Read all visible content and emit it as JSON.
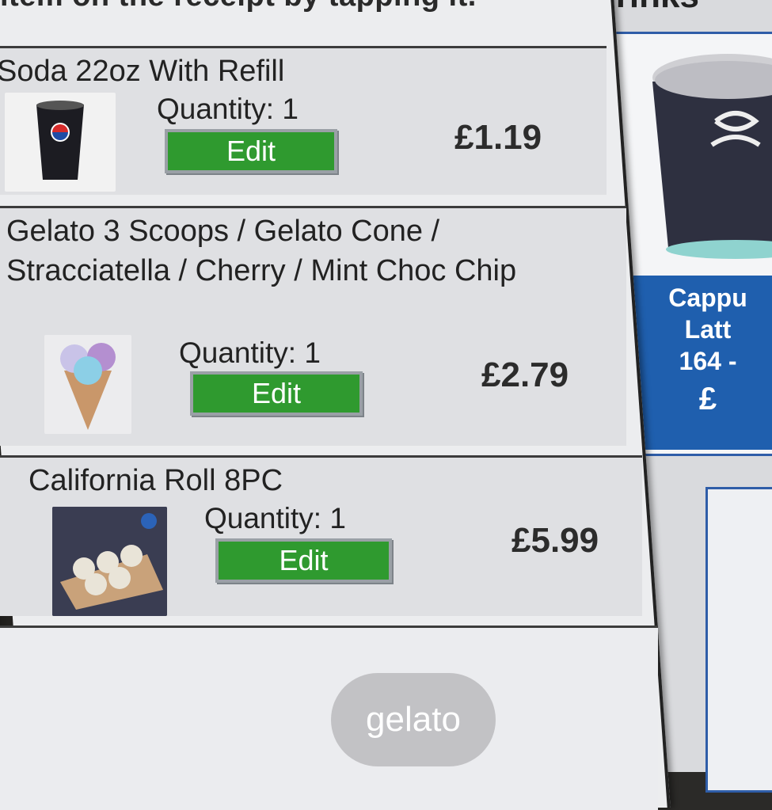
{
  "receipt": {
    "instruction": "item on the receipt by tapping it.",
    "items": [
      {
        "name": "Soda 22oz With Refill",
        "quantity": "Quantity: 1",
        "edit_label": "Edit",
        "price": "£1.19",
        "thumb_icon": "soda-cup-icon"
      },
      {
        "name": "Gelato 3 Scoops / Gelato Cone / Stracciatella / Cherry / Mint Choc Chip",
        "quantity": "Quantity: 1",
        "edit_label": "Edit",
        "price": "£2.79",
        "thumb_icon": "gelato-cone-icon"
      },
      {
        "name": "California Roll 8PC",
        "quantity": "Quantity: 1",
        "edit_label": "Edit",
        "price": "£5.99",
        "thumb_icon": "sushi-roll-icon"
      }
    ]
  },
  "drinks": {
    "title": "Drinks",
    "card": {
      "line1": "Cappu",
      "line2": "Latt",
      "line3": "164 -",
      "line4": "£"
    }
  },
  "search_pill": {
    "text": "gelato"
  },
  "colors": {
    "edit_green": "#2f9a2f",
    "drink_blue": "#1f5fae"
  }
}
